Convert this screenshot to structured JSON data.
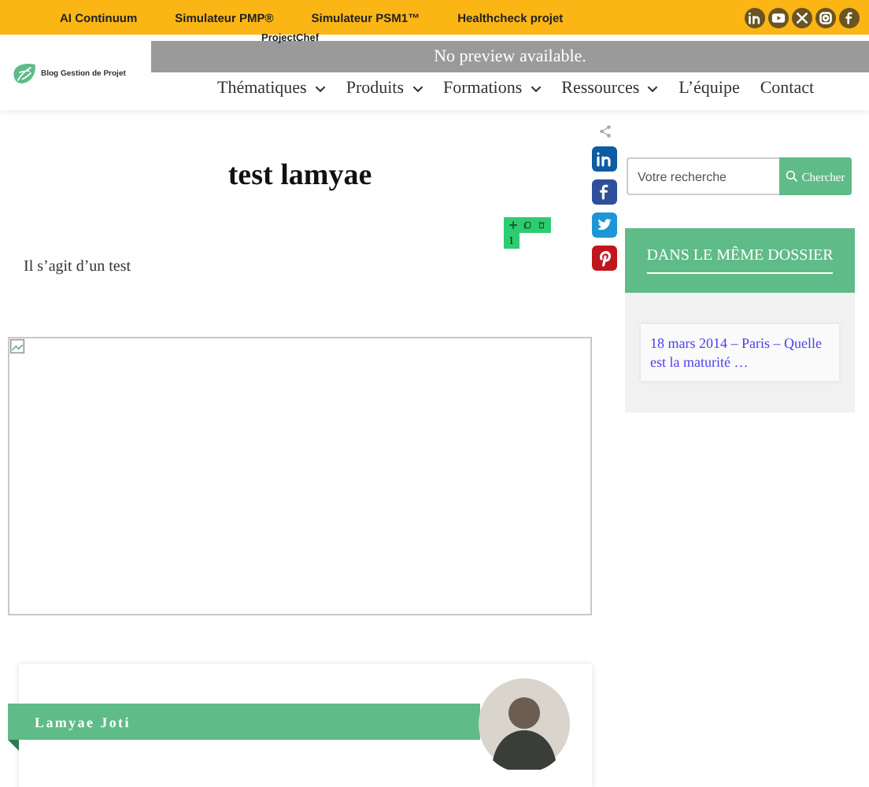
{
  "top_bar": {
    "links": [
      "AI Continuum",
      "Simulateur PMP®",
      "Simulateur PSM1™",
      "Healthcheck projet"
    ],
    "social": [
      {
        "kind": "linkedin"
      },
      {
        "kind": "youtube"
      },
      {
        "kind": "x"
      },
      {
        "kind": "instagram"
      },
      {
        "kind": "facebook"
      }
    ]
  },
  "header": {
    "logo_text": "Blog Gestion de Projet",
    "overflow_link": "ProjectChef",
    "preview_notice": "No preview available.",
    "nav": [
      {
        "label": "Thématiques",
        "dropdown": true
      },
      {
        "label": "Produits",
        "dropdown": true
      },
      {
        "label": "Formations",
        "dropdown": true
      },
      {
        "label": "Ressources",
        "dropdown": true
      },
      {
        "label": "L’équipe",
        "dropdown": false
      },
      {
        "label": "Contact",
        "dropdown": false
      }
    ]
  },
  "article": {
    "title": "test lamyae",
    "body": "Il s’agit d’un test",
    "editor_toolbar": {
      "badge": "1"
    },
    "share": [
      {
        "kind": "linkedin"
      },
      {
        "kind": "facebook"
      },
      {
        "kind": "twitter"
      },
      {
        "kind": "pinterest"
      }
    ],
    "author": {
      "name": "Lamyae Joti"
    }
  },
  "sidebar": {
    "search": {
      "placeholder": "Votre recherche",
      "button": "Chercher"
    },
    "related": {
      "heading": "DANS LE MÊME DOSSIER",
      "items": [
        "18 mars 2014 – Paris – Quelle est la maturité …"
      ]
    }
  }
}
